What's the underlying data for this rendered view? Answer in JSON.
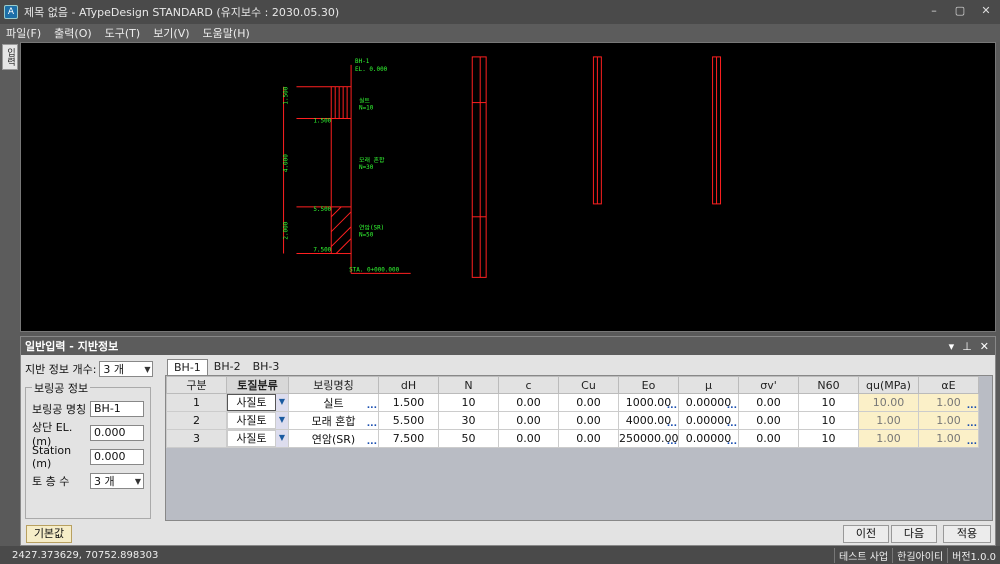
{
  "window": {
    "title": "제목 없음 - ATypeDesign STANDARD  (유지보수 : 2030.05.30)"
  },
  "menu": [
    "파일(F)",
    "출력(O)",
    "도구(T)",
    "보기(V)",
    "도움말(H)"
  ],
  "side_tab": "입력",
  "drawing": {
    "borehole_name": "BH-1",
    "el_label": "EL. 0.000",
    "depths": [
      "1.500",
      "5.500",
      "7.500"
    ],
    "thickness": [
      "1.500",
      "4.000",
      "2.000"
    ],
    "layers": [
      {
        "name": "실트",
        "n": "N=10"
      },
      {
        "name": "모래 혼합",
        "n": "N=30"
      },
      {
        "name": "연암(SR)",
        "n": "N=50"
      }
    ],
    "station_label": "STA. 0+000.000",
    "colors": {
      "line": "#ff2020",
      "text": "#33ff33",
      "bg": "#000000"
    }
  },
  "panel": {
    "title": "일반입력 - 지반정보",
    "layer_count_label": "지반 정보 개수:",
    "layer_count_value": "3 개",
    "group_title": "보링공 정보",
    "boring_name_label": "보링공 명칭",
    "boring_name_value": "BH-1",
    "top_el_label": "상단 EL.(m)",
    "top_el_value": "0.000",
    "station_label": "Station (m)",
    "station_value": "0.000",
    "soil_layers_label": "토  층  수",
    "soil_layers_value": "3 개"
  },
  "tabs": [
    "BH-1",
    "BH-2",
    "BH-3"
  ],
  "table": {
    "headers": [
      "구분",
      "토질분류",
      "보링명칭",
      "dH",
      "N",
      "c",
      "Cu",
      "Eo",
      "μ",
      "σv'",
      "N60",
      "qu(MPa)",
      "αE"
    ],
    "rows": [
      [
        "1",
        "사질토",
        "실트",
        "1.500",
        "10",
        "0.00",
        "0.00",
        "1000.00",
        "0.00000",
        "0.00",
        "10",
        "10.00",
        "1.00"
      ],
      [
        "2",
        "사질토",
        "모래 혼합",
        "5.500",
        "30",
        "0.00",
        "0.00",
        "4000.00",
        "0.00000",
        "0.00",
        "10",
        "1.00",
        "1.00"
      ],
      [
        "3",
        "사질토",
        "연암(SR)",
        "7.500",
        "50",
        "0.00",
        "0.00",
        "250000.00",
        "0.00000",
        "0.00",
        "10",
        "1.00",
        "1.00"
      ]
    ]
  },
  "buttons": {
    "default": "기본값",
    "prev": "이전",
    "next": "다음",
    "apply": "적용"
  },
  "status": {
    "coords": "2427.373629,   70752.898303",
    "items": [
      "테스트 사업",
      "한길아이티",
      "버전1.0.0"
    ]
  }
}
